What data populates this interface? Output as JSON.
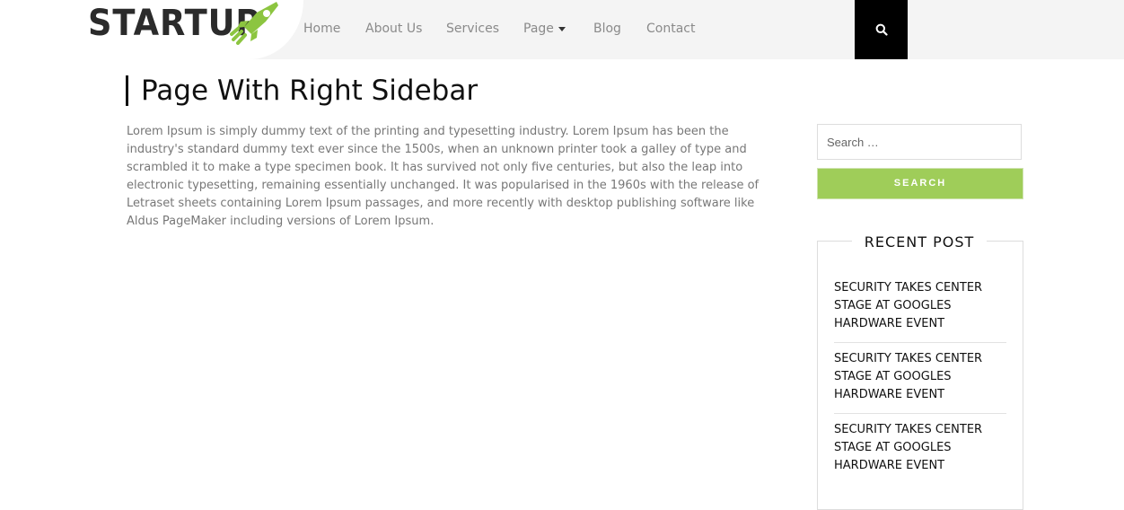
{
  "header": {
    "logo_text": "STARTUP",
    "logo_icon": "rocket-icon",
    "nav": [
      "Home",
      "About Us",
      "Services",
      "Page",
      "Blog",
      "Contact"
    ],
    "search_icon": "search-icon"
  },
  "main": {
    "title": "Page With Right Sidebar",
    "body": "Lorem Ipsum is simply dummy text of the printing and typesetting industry. Lorem Ipsum has been the industry's standard dummy text ever since the 1500s, when an unknown printer took a galley of type and scrambled it to make a type specimen book. It has survived not only five centuries, but also the leap into electronic typesetting, remaining essentially unchanged. It was popularised in the 1960s with the release of Letraset sheets containing Lorem Ipsum passages, and more recently with desktop publishing software like Aldus PageMaker including versions of Lorem Ipsum."
  },
  "sidebar": {
    "search_placeholder": "Search …",
    "search_button": "SEARCH",
    "recent_title": "RECENT POST",
    "posts": [
      "SECURITY TAKES CENTER STAGE AT GOOGLES HARDWARE EVENT",
      "SECURITY TAKES CENTER STAGE AT GOOGLES HARDWARE EVENT",
      "SECURITY TAKES CENTER STAGE AT GOOGLES HARDWARE EVENT"
    ]
  },
  "colors": {
    "accent": "#9fcd59",
    "header_bg": "#f4f4f4",
    "search_btn_bg": "#000000"
  }
}
